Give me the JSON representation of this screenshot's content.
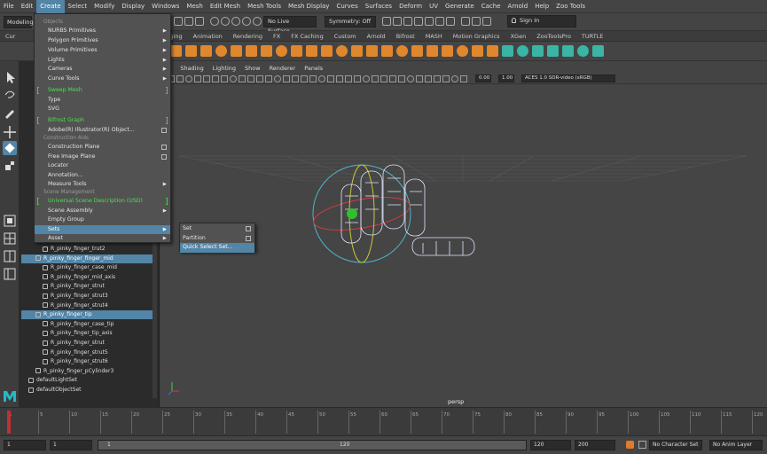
{
  "menubar": {
    "items": [
      "File",
      "Edit",
      "Create",
      "Select",
      "Modify",
      "Display",
      "Windows",
      "Mesh",
      "Edit Mesh",
      "Mesh Tools",
      "Mesh Display",
      "Curves",
      "Surfaces",
      "Deform",
      "UV",
      "Generate",
      "Cache",
      "Arnold",
      "Help",
      "Zoo Tools"
    ],
    "active_index": 2
  },
  "status_line": {
    "mode": "Modeling",
    "live_surface": "No Live Surface",
    "symmetry": "Symmetry: Off",
    "signin": "Sign In"
  },
  "shelf": {
    "tabs": [
      "Cur",
      "gging",
      "Animation",
      "Rendering",
      "FX",
      "FX Caching",
      "Custom",
      "Arnold",
      "Bifrost",
      "MASH",
      "Motion Graphics",
      "XGen",
      "ZooToolsPro",
      "TURTLE"
    ]
  },
  "panel": {
    "menus": [
      "ew",
      "Shading",
      "Lighting",
      "Show",
      "Renderer",
      "Panels"
    ],
    "near": "0.00",
    "far": "1.00",
    "colorspace": "ACES 1.0 SDR-video (sRGB)",
    "camera": "persp"
  },
  "create_menu": {
    "sections": {
      "objects": "Objects",
      "construction_aids": "Construction Aids",
      "scene_management": "Scene Management"
    },
    "items": {
      "nurbs": "NURBS Primitives",
      "polygon": "Polygon Primitives",
      "volume": "Volume Primitives",
      "lights": "Lights",
      "cameras": "Cameras",
      "curve_tools": "Curve Tools",
      "sweep_mesh": "Sweep Mesh",
      "type": "Type",
      "svg": "SVG",
      "bifrost_graph": "Bifrost Graph",
      "illustrator": "Adobe(R) Illustrator(R) Object...",
      "construction_plane": "Construction Plane",
      "free_image_plane": "Free Image Plane",
      "locator": "Locator",
      "annotation": "Annotation...",
      "measure_tools": "Measure Tools",
      "usd": "Universal Scene Description (USD)",
      "scene_assembly": "Scene Assembly",
      "empty_group": "Empty Group",
      "sets": "Sets",
      "asset": "Asset"
    }
  },
  "sets_menu": {
    "items": [
      "Set",
      "Partition",
      "Quick Select Set..."
    ]
  },
  "outliner": {
    "rows": [
      {
        "label": "R_pinky_finger_trut2",
        "indent": 2,
        "selected": false
      },
      {
        "label": "R_pinky_finger_finger_mid",
        "indent": 1,
        "selected": true
      },
      {
        "label": "R_pinky_finger_case_mid",
        "indent": 2,
        "selected": false
      },
      {
        "label": "R_pinky_finger_mid_axis",
        "indent": 2,
        "selected": false
      },
      {
        "label": "R_pinky_finger_strut",
        "indent": 2,
        "selected": false
      },
      {
        "label": "R_pinky_finger_strut3",
        "indent": 2,
        "selected": false
      },
      {
        "label": "R_pinky_finger_strut4",
        "indent": 2,
        "selected": false
      },
      {
        "label": "R_pinky_finger_tip",
        "indent": 1,
        "selected": true
      },
      {
        "label": "R_pinky_finger_case_tip",
        "indent": 2,
        "selected": false
      },
      {
        "label": "R_pinky_finger_tip_axis",
        "indent": 2,
        "selected": false
      },
      {
        "label": "R_pinky_finger_strut",
        "indent": 2,
        "selected": false
      },
      {
        "label": "R_pinky_finger_strut5",
        "indent": 2,
        "selected": false
      },
      {
        "label": "R_pinky_finger_strut6",
        "indent": 2,
        "selected": false
      },
      {
        "label": "R_pinky_finger_pCylinder3",
        "indent": 1,
        "selected": false
      },
      {
        "label": "defaultLightSet",
        "indent": 0,
        "selected": false
      },
      {
        "label": "defaultObjectSet",
        "indent": 0,
        "selected": false
      }
    ]
  },
  "timeline": {
    "ticks": [
      "1",
      "5",
      "10",
      "15",
      "20",
      "25",
      "30",
      "35",
      "40",
      "45",
      "50",
      "55",
      "60",
      "65",
      "70",
      "75",
      "80",
      "85",
      "90",
      "95",
      "100",
      "105",
      "110",
      "115",
      "120"
    ],
    "start": "1",
    "playback_start": "1",
    "range_start": "1",
    "range_end": "120",
    "playback_end": "120",
    "end": "200",
    "character_set": "No Character Set",
    "anim_layer": "No Anim Layer"
  },
  "colors": {
    "highlight": "#5285a6",
    "green": "#4ee04e",
    "menu_bg": "#525252"
  }
}
